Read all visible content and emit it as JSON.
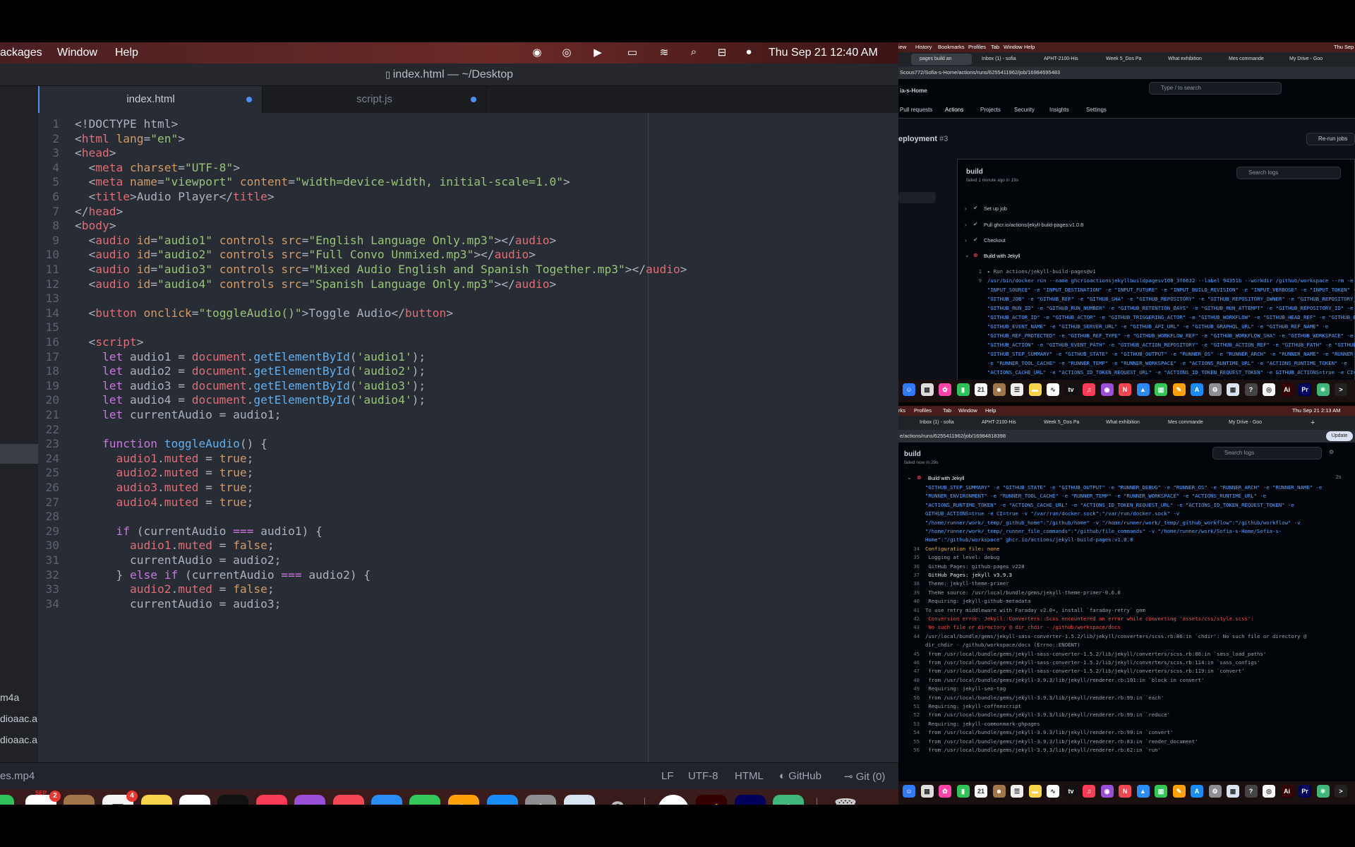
{
  "menubar": {
    "items": [
      "ackages",
      "Window",
      "Help"
    ],
    "clock": "Thu Sep 21  12:40 AM"
  },
  "window": {
    "title": "index.html — ~/Desktop"
  },
  "tabs": [
    {
      "label": "index.html"
    },
    {
      "label": "script.js"
    }
  ],
  "tree": {
    "files": [
      "m4a",
      "dioaac.a",
      "dioaac.a",
      "es.mp4"
    ],
    "count": "3"
  },
  "code": {
    "lines": [
      [
        [
          "cm",
          "<!DOCTYPE html>"
        ]
      ],
      [
        [
          "cm",
          "<"
        ],
        [
          "tg",
          "html"
        ],
        [
          "at",
          " lang"
        ],
        [
          "cm",
          "="
        ],
        [
          "sv",
          "\"en\""
        ],
        [
          "cm",
          ">"
        ]
      ],
      [
        [
          "cm",
          "<"
        ],
        [
          "tg",
          "head"
        ],
        [
          "cm",
          ">"
        ]
      ],
      [
        [
          "cm",
          "  <"
        ],
        [
          "tg",
          "meta"
        ],
        [
          "at",
          " charset"
        ],
        [
          "cm",
          "="
        ],
        [
          "sv",
          "\"UTF-8\""
        ],
        [
          "cm",
          ">"
        ]
      ],
      [
        [
          "cm",
          "  <"
        ],
        [
          "tg",
          "meta"
        ],
        [
          "at",
          " name"
        ],
        [
          "cm",
          "="
        ],
        [
          "sv",
          "\"viewport\""
        ],
        [
          "at",
          " content"
        ],
        [
          "cm",
          "="
        ],
        [
          "sv",
          "\"width=device-width, initial-scale=1.0\""
        ],
        [
          "cm",
          ">"
        ]
      ],
      [
        [
          "cm",
          "  <"
        ],
        [
          "tg",
          "title"
        ],
        [
          "cm",
          ">Audio Player</"
        ],
        [
          "tg",
          "title"
        ],
        [
          "cm",
          ">"
        ]
      ],
      [
        [
          "cm",
          "</"
        ],
        [
          "tg",
          "head"
        ],
        [
          "cm",
          ">"
        ]
      ],
      [
        [
          "cm",
          "<"
        ],
        [
          "tg",
          "body"
        ],
        [
          "cm",
          ">"
        ]
      ],
      [
        [
          "cm",
          "  <"
        ],
        [
          "tg",
          "audio"
        ],
        [
          "at",
          " id"
        ],
        [
          "cm",
          "="
        ],
        [
          "sv",
          "\"audio1\""
        ],
        [
          "at",
          " controls src"
        ],
        [
          "cm",
          "="
        ],
        [
          "sv",
          "\"English Language Only.mp3\""
        ],
        [
          "cm",
          "></"
        ],
        [
          "tg",
          "audio"
        ],
        [
          "cm",
          ">"
        ]
      ],
      [
        [
          "cm",
          "  <"
        ],
        [
          "tg",
          "audio"
        ],
        [
          "at",
          " id"
        ],
        [
          "cm",
          "="
        ],
        [
          "sv",
          "\"audio2\""
        ],
        [
          "at",
          " controls src"
        ],
        [
          "cm",
          "="
        ],
        [
          "sv",
          "\"Full Convo Unmixed.mp3\""
        ],
        [
          "cm",
          "></"
        ],
        [
          "tg",
          "audio"
        ],
        [
          "cm",
          ">"
        ]
      ],
      [
        [
          "cm",
          "  <"
        ],
        [
          "tg",
          "audio"
        ],
        [
          "at",
          " id"
        ],
        [
          "cm",
          "="
        ],
        [
          "sv",
          "\"audio3\""
        ],
        [
          "at",
          " controls src"
        ],
        [
          "cm",
          "="
        ],
        [
          "sv",
          "\"Mixed Audio English and Spanish Together.mp3\""
        ],
        [
          "cm",
          "></"
        ],
        [
          "tg",
          "audio"
        ],
        [
          "cm",
          ">"
        ]
      ],
      [
        [
          "cm",
          "  <"
        ],
        [
          "tg",
          "audio"
        ],
        [
          "at",
          " id"
        ],
        [
          "cm",
          "="
        ],
        [
          "sv",
          "\"audio4\""
        ],
        [
          "at",
          " controls src"
        ],
        [
          "cm",
          "="
        ],
        [
          "sv",
          "\"Spanish Language Only.mp3\""
        ],
        [
          "cm",
          "></"
        ],
        [
          "tg",
          "audio"
        ],
        [
          "cm",
          ">"
        ]
      ],
      [
        [
          "cm",
          ""
        ]
      ],
      [
        [
          "cm",
          "  <"
        ],
        [
          "tg",
          "button"
        ],
        [
          "at",
          " onclick"
        ],
        [
          "cm",
          "="
        ],
        [
          "sv",
          "\"toggleAudio()\""
        ],
        [
          "cm",
          ">Toggle Audio</"
        ],
        [
          "tg",
          "button"
        ],
        [
          "cm",
          ">"
        ]
      ],
      [
        [
          "cm",
          ""
        ]
      ],
      [
        [
          "cm",
          "  <"
        ],
        [
          "tg",
          "script"
        ],
        [
          "cm",
          ">"
        ]
      ],
      [
        [
          "kw",
          "    let"
        ],
        [
          "cm",
          " audio1 = "
        ],
        [
          "tg",
          "document"
        ],
        [
          "cm",
          "."
        ],
        [
          "fn",
          "getElementById"
        ],
        [
          "cm",
          "("
        ],
        [
          "sv",
          "'audio1'"
        ],
        [
          "cm",
          ");"
        ]
      ],
      [
        [
          "kw",
          "    let"
        ],
        [
          "cm",
          " audio2 = "
        ],
        [
          "tg",
          "document"
        ],
        [
          "cm",
          "."
        ],
        [
          "fn",
          "getElementById"
        ],
        [
          "cm",
          "("
        ],
        [
          "sv",
          "'audio2'"
        ],
        [
          "cm",
          ");"
        ]
      ],
      [
        [
          "kw",
          "    let"
        ],
        [
          "cm",
          " audio3 = "
        ],
        [
          "tg",
          "document"
        ],
        [
          "cm",
          "."
        ],
        [
          "fn",
          "getElementById"
        ],
        [
          "cm",
          "("
        ],
        [
          "sv",
          "'audio3'"
        ],
        [
          "cm",
          ");"
        ]
      ],
      [
        [
          "kw",
          "    let"
        ],
        [
          "cm",
          " audio4 = "
        ],
        [
          "tg",
          "document"
        ],
        [
          "cm",
          "."
        ],
        [
          "fn",
          "getElementById"
        ],
        [
          "cm",
          "("
        ],
        [
          "sv",
          "'audio4'"
        ],
        [
          "cm",
          ");"
        ]
      ],
      [
        [
          "kw",
          "    let"
        ],
        [
          "cm",
          " currentAudio = audio1;"
        ]
      ],
      [
        [
          "cm",
          ""
        ]
      ],
      [
        [
          "kw",
          "    function"
        ],
        [
          "fn",
          " toggleAudio"
        ],
        [
          "cm",
          "() {"
        ]
      ],
      [
        [
          "tg",
          "      audio1"
        ],
        [
          "cm",
          "."
        ],
        [
          "tg",
          "muted"
        ],
        [
          "cm",
          " = "
        ],
        [
          "at",
          "true"
        ],
        [
          "cm",
          ";"
        ]
      ],
      [
        [
          "tg",
          "      audio2"
        ],
        [
          "cm",
          "."
        ],
        [
          "tg",
          "muted"
        ],
        [
          "cm",
          " = "
        ],
        [
          "at",
          "true"
        ],
        [
          "cm",
          ";"
        ]
      ],
      [
        [
          "tg",
          "      audio3"
        ],
        [
          "cm",
          "."
        ],
        [
          "tg",
          "muted"
        ],
        [
          "cm",
          " = "
        ],
        [
          "at",
          "true"
        ],
        [
          "cm",
          ";"
        ]
      ],
      [
        [
          "tg",
          "      audio4"
        ],
        [
          "cm",
          "."
        ],
        [
          "tg",
          "muted"
        ],
        [
          "cm",
          " = "
        ],
        [
          "at",
          "true"
        ],
        [
          "cm",
          ";"
        ]
      ],
      [
        [
          "cm",
          ""
        ]
      ],
      [
        [
          "kw",
          "      if"
        ],
        [
          "cm",
          " (currentAudio "
        ],
        [
          "kw",
          "==="
        ],
        [
          "cm",
          " audio1) {"
        ]
      ],
      [
        [
          "tg",
          "        audio1"
        ],
        [
          "cm",
          "."
        ],
        [
          "tg",
          "muted"
        ],
        [
          "cm",
          " = "
        ],
        [
          "at",
          "false"
        ],
        [
          "cm",
          ";"
        ]
      ],
      [
        [
          "cm",
          "        currentAudio = audio2;"
        ]
      ],
      [
        [
          "cm",
          "      } "
        ],
        [
          "kw",
          "else if"
        ],
        [
          "cm",
          " (currentAudio "
        ],
        [
          "kw",
          "==="
        ],
        [
          "cm",
          " audio2) {"
        ]
      ],
      [
        [
          "tg",
          "        audio2"
        ],
        [
          "cm",
          "."
        ],
        [
          "tg",
          "muted"
        ],
        [
          "cm",
          " = "
        ],
        [
          "at",
          "false"
        ],
        [
          "cm",
          ";"
        ]
      ],
      [
        [
          "cm",
          "        currentAudio = audio3;"
        ]
      ]
    ]
  },
  "status": {
    "lf": "LF",
    "enc": "UTF-8",
    "lang": "HTML",
    "github": "GitHub",
    "git": "Git (0)"
  },
  "dock": {
    "calendar_month": "SEP",
    "calendar_day": "21",
    "calendar_badge": "2",
    "reminders_badge": "4",
    "appletv": "tv",
    "ai": "Ai",
    "pr": "Pr"
  },
  "rtop": {
    "menu": [
      "iew",
      "History",
      "Bookmarks",
      "Profiles",
      "Tab",
      "Window",
      "Help"
    ],
    "clock": "Thu Sep",
    "tabs": [
      "pages build an",
      "Inbox (1) - sofia",
      "APHT-2100-His",
      "Week 5_Dos Pa",
      "What exhibition",
      "Mes commande",
      "My Drive - Goo"
    ],
    "url": "Scous772/Sofia-s-Home/actions/runs/6255411962/job/16984695483",
    "repo": "ia-s-Home",
    "search": "Type / to search",
    "nav": [
      "Pull requests",
      "Actions",
      "Projects",
      "Security",
      "Insights",
      "Settings"
    ],
    "run": "eployment",
    "run_num": "#3",
    "rerun": "Re-run jobs",
    "job": "build",
    "job_sub": "failed 1 minute ago in 19s",
    "searchlogs": "Search logs",
    "steps": [
      "Set up job",
      "Pull ghcr.io/actions/jekyll-build-pages:v1.0.8",
      "Checkout",
      "Build with Jekyll"
    ],
    "logs": [
      [
        "1",
        "gr",
        "▸ Run actions/jekyll-build-pages@v1"
      ],
      [
        "9",
        "bl",
        "/usr/bin/docker run --name ghcrioactionsjekyllbuildpagesv108_3f6632 --label 94351b --workdir /github/workspace --rm -e"
      ],
      [
        "",
        "bl",
        "\"INPUT_SOURCE\" -e \"INPUT_DESTINATION\" -e \"INPUT_FUTURE\" -e \"INPUT_BUILD_REVISION\" -e \"INPUT_VERBOSE\" -e \"INPUT_TOKEN\" -e \"HOME\""
      ],
      [
        "",
        "bl",
        "\"GITHUB_JOB\" -e \"GITHUB_REF\" -e \"GITHUB_SHA\" -e \"GITHUB_REPOSITORY\" -e \"GITHUB_REPOSITORY_OWNER\" -e \"GITHUB_REPOSITORY_OWNER_"
      ],
      [
        "",
        "bl",
        "\"GITHUB_RUN_ID\" -e \"GITHUB_RUN_NUMBER\" -e \"GITHUB_RETENTION_DAYS\" -e \"GITHUB_RUN_ATTEMPT\" -e \"GITHUB_REPOSITORY_ID\" -e"
      ],
      [
        "",
        "bl",
        "\"GITHUB_ACTOR_ID\" -e \"GITHUB_ACTOR\" -e \"GITHUB_TRIGGERING_ACTOR\" -e \"GITHUB_WORKFLOW\" -e \"GITHUB_HEAD_REF\" -e \"GITHUB_BASE_RE"
      ],
      [
        "",
        "bl",
        "\"GITHUB_EVENT_NAME\" -e \"GITHUB_SERVER_URL\" -e \"GITHUB_API_URL\" -e \"GITHUB_GRAPHQL_URL\" -e \"GITHUB_REF_NAME\" -e"
      ],
      [
        "",
        "bl",
        "\"GITHUB_REF_PROTECTED\" -e \"GITHUB_REF_TYPE\" -e \"GITHUB_WORKFLOW_REF\" -e \"GITHUB_WORKFLOW_SHA\" -e \"GITHUB_WORKSPACE\" -e"
      ],
      [
        "",
        "bl",
        "\"GITHUB_ACTION\" -e \"GITHUB_EVENT_PATH\" -e \"GITHUB_ACTION_REPOSITORY\" -e \"GITHUB_ACTION_REF\" -e \"GITHUB_PATH\" -e \"GITHUB_ENV\""
      ],
      [
        "",
        "bl",
        "\"GITHUB_STEP_SUMMARY\" -e \"GITHUB_STATE\" -e \"GITHUB_OUTPUT\" -e \"RUNNER_OS\" -e \"RUNNER_ARCH\" -e \"RUNNER_NAME\" -e \"RUNNER_ENVIRO"
      ],
      [
        "",
        "bl",
        "-e \"RUNNER_TOOL_CACHE\" -e \"RUNNER_TEMP\" -e \"RUNNER_WORKSPACE\" -e \"ACTIONS_RUNTIME_URL\" -e \"ACTIONS_RUNTIME_TOKEN\" -e"
      ],
      [
        "",
        "bl",
        "\"ACTIONS_CACHE_URL\" -e \"ACTIONS_ID_TOKEN_REQUEST_URL\" -e \"ACTIONS_ID_TOKEN_REQUEST_TOKEN\" -e GITHUB_ACTIONS=true -e CI=true -"
      ],
      [
        "",
        "bl",
        "\"/var/run/docker.sock\":\"/var/run/docker.sock\" -v \"/home/runner/work/_temp/_github_home\":\"/github/home\" -v"
      ],
      [
        "",
        "bl",
        "\"/home/runner/work/_temp/_github_workflow\":\"/github/workflow\" -v"
      ]
    ],
    "dock": {
      "cal": "21"
    }
  },
  "rbot": {
    "menu": [
      "rks",
      "Profiles",
      "Tab",
      "Window",
      "Help"
    ],
    "clock": "Thu Sep 21  2:13 AM",
    "tabs": [
      "Inbox (1) - sofia",
      "APHT-2100-His",
      "Week 5_Dos Pa",
      "What exhibition",
      "Mes commande",
      "My Drive - Goo"
    ],
    "url": "e/actions/runs/6255411962/job/16984818398",
    "update": "Update",
    "job": "build",
    "job_sub": "failed now in 29s",
    "searchlogs": "Search logs",
    "step": "Build with Jekyll",
    "step_time": "2s",
    "logs": [
      [
        "",
        "bl",
        "\"GITHUB_STEP_SUMMARY\" -e \"GITHUB_STATE\" -e \"GITHUB_OUTPUT\" -e \"RUNNER_DEBUG\" -e \"RUNNER_OS\" -e \"RUNNER_ARCH\" -e \"RUNNER_NAME\" -e"
      ],
      [
        "",
        "bl",
        "\"RUNNER_ENVIRONMENT\" -e \"RUNNER_TOOL_CACHE\" -e \"RUNNER_TEMP\" -e \"RUNNER_WORKSPACE\" -e \"ACTIONS_RUNTIME_URL\" -e"
      ],
      [
        "",
        "bl",
        "\"ACTIONS_RUNTIME_TOKEN\" -e \"ACTIONS_CACHE_URL\" -e \"ACTIONS_ID_TOKEN_REQUEST_URL\" -e \"ACTIONS_ID_TOKEN_REQUEST_TOKEN\" -e"
      ],
      [
        "",
        "bl",
        "GITHUB_ACTIONS=true -e CI=true -v \"/var/run/docker.sock\":\"/var/run/docker.sock\" -v"
      ],
      [
        "",
        "bl",
        "\"/home/runner/work/_temp/_github_home\":\"/github/home\" -v \"/home/runner/work/_temp/_github_workflow\":\"/github/workflow\" -v"
      ],
      [
        "",
        "bl",
        "\"/home/runner/work/_temp/_runner_file_commands\":\"/github/file_commands\" -v \"/home/runner/work/Sofia-s-Home/Sofia-s-"
      ],
      [
        "",
        "bl",
        "Home\":\"/github/workspace\" ghcr.io/actions/jekyll-build-pages:v1.0.8"
      ],
      [
        "34",
        "yl",
        "Configuration file: none"
      ],
      [
        "35",
        "gr",
        "  Logging at level: debug"
      ],
      [
        "36",
        "gr",
        "      GitHub Pages: github-pages v228"
      ],
      [
        "37",
        "wt",
        "      GitHub Pages: jekyll v3.9.3"
      ],
      [
        "38",
        "gr",
        "             Theme: jekyll-theme-primer"
      ],
      [
        "39",
        "gr",
        "      Theme source: /usr/local/bundle/gems/jekyll-theme-primer-0.6.0"
      ],
      [
        "40",
        "gr",
        "         Requiring: jekyll-github-metadata"
      ],
      [
        "41",
        "gr",
        "To use retry middleware with Faraday v2.0+, install `faraday-retry` gem"
      ],
      [
        "42",
        "rd",
        "  Conversion error: Jekyll::Converters::Scss encountered an error while converting 'assets/css/style.scss':"
      ],
      [
        "43",
        "rd",
        "                    No such file or directory @ dir_chdir - /github/workspace/docs"
      ],
      [
        "44",
        "gr",
        "/usr/local/bundle/gems/jekyll-sass-converter-1.5.2/lib/jekyll/converters/scss.rb:86:in `chdir': No such file or directory @"
      ],
      [
        "",
        "gr",
        "dir_chdir - /github/workspace/docs (Errno::ENOENT)"
      ],
      [
        "45",
        "gr",
        "        from /usr/local/bundle/gems/jekyll-sass-converter-1.5.2/lib/jekyll/converters/scss.rb:86:in `sass_load_paths'"
      ],
      [
        "46",
        "gr",
        "        from /usr/local/bundle/gems/jekyll-sass-converter-1.5.2/lib/jekyll/converters/scss.rb:114:in `sass_configs'"
      ],
      [
        "47",
        "gr",
        "        from /usr/local/bundle/gems/jekyll-sass-converter-1.5.2/lib/jekyll/converters/scss.rb:119:in `convert'"
      ],
      [
        "48",
        "gr",
        "        from /usr/local/bundle/gems/jekyll-3.9.3/lib/jekyll/renderer.rb:101:in `block in convert'"
      ],
      [
        "49",
        "gr",
        "         Requiring: jekyll-seo-tag"
      ],
      [
        "50",
        "gr",
        "        from /usr/local/bundle/gems/jekyll-3.9.3/lib/jekyll/renderer.rb:99:in `each'"
      ],
      [
        "51",
        "gr",
        "         Requiring: jekyll-coffeescript"
      ],
      [
        "52",
        "gr",
        "        from /usr/local/bundle/gems/jekyll-3.9.3/lib/jekyll/renderer.rb:99:in `reduce'"
      ],
      [
        "53",
        "gr",
        "         Requiring: jekyll-commonmark-ghpages"
      ],
      [
        "54",
        "gr",
        "        from /usr/local/bundle/gems/jekyll-3.9.3/lib/jekyll/renderer.rb:99:in `convert'"
      ],
      [
        "55",
        "gr",
        "        from /usr/local/bundle/gems/jekyll-3.9.3/lib/jekyll/renderer.rb:83:in `render_document'"
      ],
      [
        "56",
        "gr",
        "        from /usr/local/bundle/gems/jekyll-3.9.3/lib/jekyll/renderer.rb:62:in `run'"
      ]
    ],
    "dock": {
      "cal": "21"
    }
  }
}
